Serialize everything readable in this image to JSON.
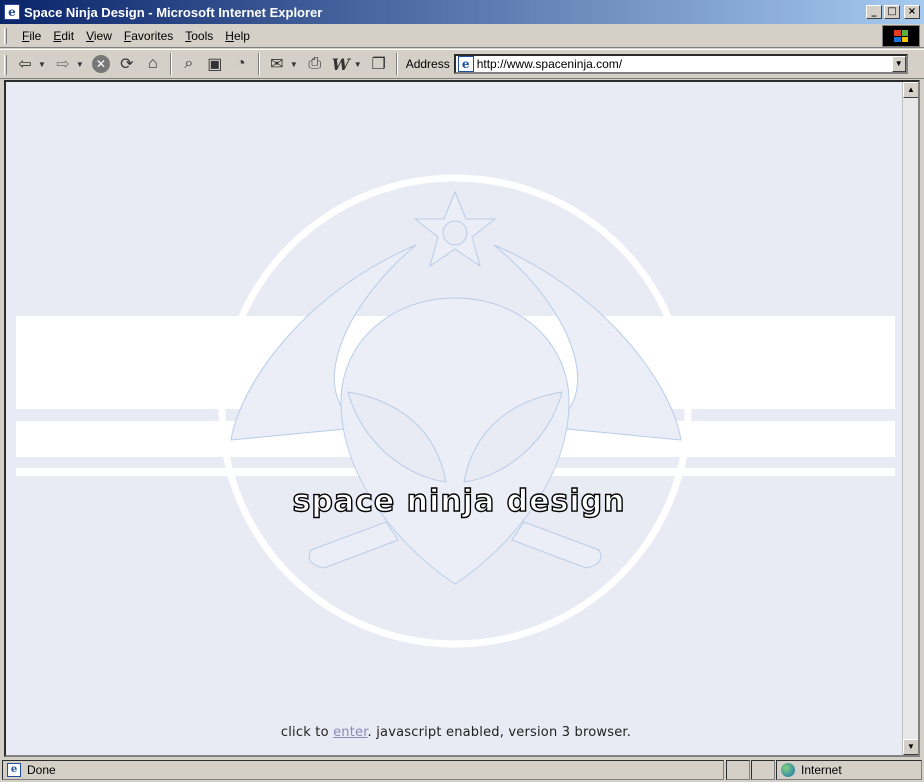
{
  "window": {
    "title": "Space Ninja Design - Microsoft Internet Explorer",
    "buttons": [
      "_",
      "□",
      "×"
    ]
  },
  "menu": {
    "items": [
      {
        "underline": "F",
        "rest": "ile"
      },
      {
        "underline": "E",
        "rest": "dit"
      },
      {
        "underline": "V",
        "rest": "iew"
      },
      {
        "underline": "F",
        "rest": "avorites"
      },
      {
        "underline": "T",
        "rest": "ools"
      },
      {
        "underline": "H",
        "rest": "elp"
      }
    ]
  },
  "toolbar": {
    "address_label": "Address",
    "url": "http://www.spaceninja.com/"
  },
  "page": {
    "brand": "space ninja design",
    "footer_prefix": "click to ",
    "footer_link": "enter",
    "footer_suffix": ". javascript enabled, version 3 browser."
  },
  "status": {
    "text": "Done",
    "zone": "Internet"
  },
  "colors": {
    "page_bg": "#e8eaf4",
    "logo_line": "#b8cce8",
    "link": "#8a8ab8"
  }
}
